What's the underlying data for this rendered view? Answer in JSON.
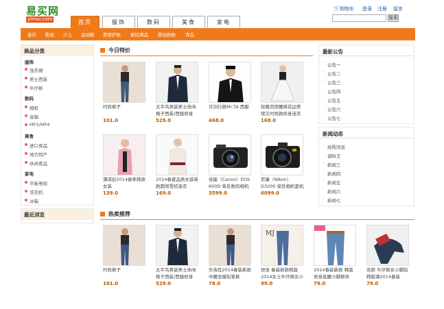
{
  "brand": {
    "name": "易买网",
    "domain": "yimai.com"
  },
  "toplinks": {
    "cart": "购物车",
    "login": "登录",
    "register": "注册",
    "message": "留言"
  },
  "search": {
    "button": "搜索"
  },
  "main_tabs": [
    "首页",
    "服饰",
    "数码",
    "美食",
    "家电"
  ],
  "sub_nav": [
    "音乐",
    "影视",
    "少儿",
    "运动鞋",
    "美容护肤",
    "家纺用品",
    "婴幼奶粉",
    "饰品"
  ],
  "categories": {
    "title": "商品分类",
    "groups": [
      {
        "name": "服饰",
        "items": [
          "连衣裙",
          "男士西装",
          "牛仔裤"
        ]
      },
      {
        "name": "数码",
        "items": [
          "相机",
          "音箱",
          "MP3/MP4"
        ]
      },
      {
        "name": "美食",
        "items": [
          "进口食品",
          "地方特产",
          "休闲食品"
        ]
      },
      {
        "name": "家电",
        "items": [
          "平板电视",
          "洗衣机",
          "冰箱"
        ]
      }
    ]
  },
  "recent": {
    "title": "最近浏览"
  },
  "today_special": {
    "title": "今日特价",
    "products": [
      {
        "name": "时尚裤子",
        "price": "101.0",
        "img": "jeans"
      },
      {
        "name": "太平鸟男装男士休闲格子西装/西服修身",
        "price": "529.0",
        "img": "suit"
      },
      {
        "name": "许剑行款Mr.TA 西服",
        "price": "468.0",
        "img": "blazer"
      },
      {
        "name": "轻晨百搭腰裤花边美观又时尚款修身连衣裙",
        "price": "168.0",
        "img": "dress"
      },
      {
        "name": "蒲诺妃2014春季韩款女装",
        "price": "139.0",
        "img": "jacket"
      },
      {
        "name": "2014春夏品质女装新款圆领雪纺连衣",
        "price": "169.0",
        "img": "blouse"
      },
      {
        "name": "佳能（Canon）EOS 600D 单反数码相机",
        "price": "3599.0",
        "img": "camera-canon"
      },
      {
        "name": "尼康（Nikon）D3200 单反相机套机",
        "price": "6099.0",
        "img": "camera-nikon"
      }
    ]
  },
  "hot": {
    "title": "热卖推荐",
    "products": [
      {
        "name": "时尚裤子",
        "price": "101.0",
        "img": "jeans"
      },
      {
        "name": "太平鸟男装男士休闲格子西装/西服修身",
        "price": "529.0",
        "img": "suit"
      },
      {
        "name": "乐淘优2014春装新款中腰显瘦铅笔裤",
        "price": "78.0",
        "img": "jeans"
      },
      {
        "name": "捏佳 春装新款韩版2014女士牛仔裤女小脚",
        "price": "99.0",
        "img": "jeans-mj"
      },
      {
        "name": "2014春装新款 韩版修身直腰小脚裤休",
        "price": "79.0",
        "img": "jeans-belt"
      },
      {
        "name": "名欧 牛仔裤女小脚铅韩版潮2014春装",
        "price": "79.0",
        "img": "leggings"
      }
    ]
  },
  "notices": {
    "title": "最新公告",
    "items": [
      "公告一",
      "公告二",
      "公告三",
      "公告四",
      "公告五",
      "公告六",
      "公告七"
    ]
  },
  "news": {
    "title": "新闻动态",
    "items": [
      "抢购消息",
      "调料王",
      "新闻三",
      "新闻四",
      "新闻五",
      "新闻六",
      "新闻七"
    ]
  }
}
